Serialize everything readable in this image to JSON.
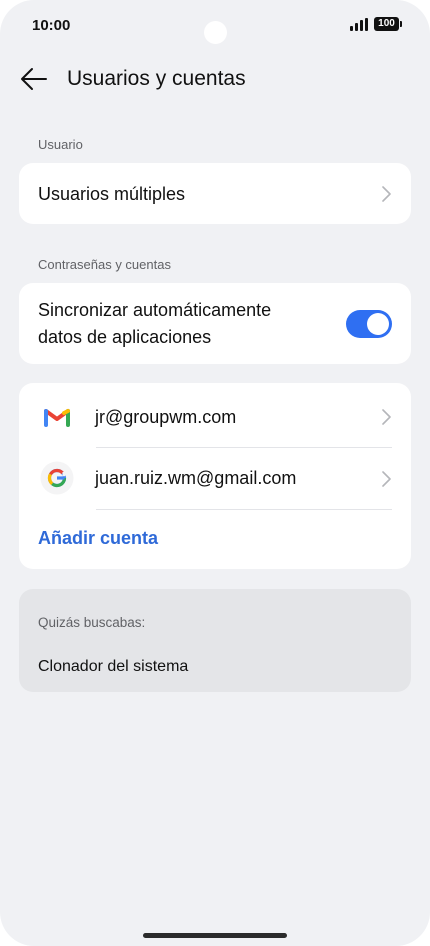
{
  "status_bar": {
    "time": "10:00",
    "battery": "100"
  },
  "header": {
    "title": "Usuarios y cuentas"
  },
  "sections": {
    "user": {
      "label": "Usuario",
      "multiple_users": "Usuarios múltiples"
    },
    "accounts": {
      "label": "Contraseñas y cuentas",
      "sync_label": "Sincronizar automáticamente datos de aplicaciones",
      "sync_line1": "Sincronizar automáticamente",
      "sync_line2": "datos de aplicaciones",
      "sync_enabled": true
    }
  },
  "accounts": [
    {
      "icon": "gmail-icon",
      "email": "jr@groupwm.com"
    },
    {
      "icon": "google-icon",
      "email": "juan.ruiz.wm@gmail.com"
    }
  ],
  "add_account": "Añadir cuenta",
  "suggestions": {
    "label": "Quizás buscabas:",
    "item": "Clonador del sistema"
  },
  "colors": {
    "accent": "#2f6ff2",
    "link": "#2f6ad8",
    "background": "#f0f1f4"
  }
}
